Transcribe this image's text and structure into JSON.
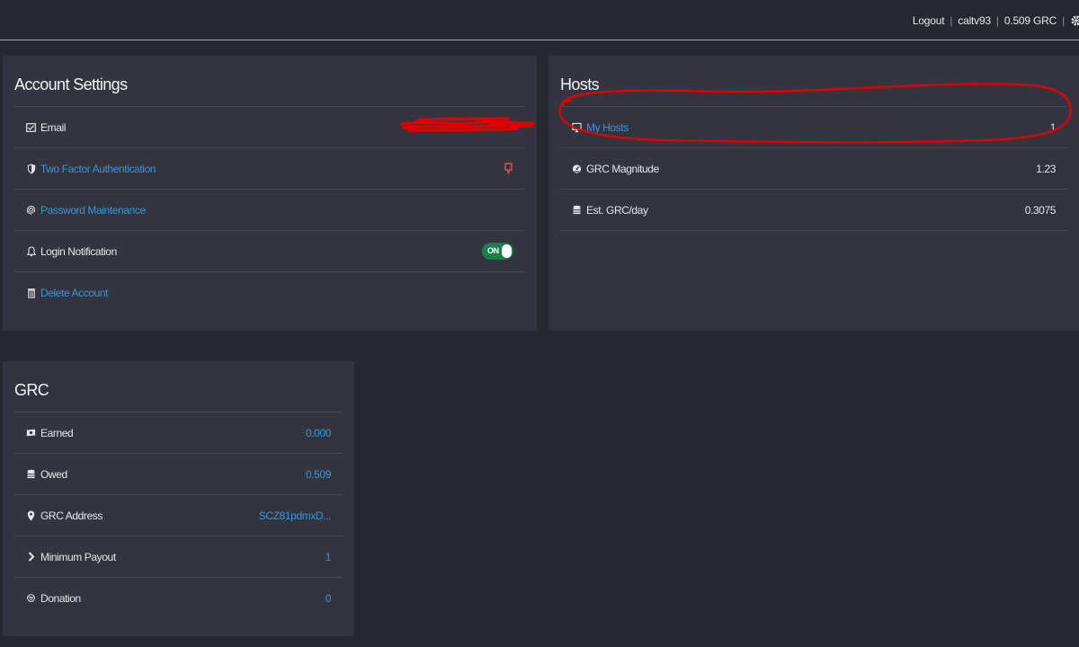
{
  "topnav": {
    "logout": "Logout",
    "username": "caltv93",
    "balance": "0.509 GRC"
  },
  "account": {
    "title": "Account Settings",
    "email_label": "Email",
    "twofa_label": "Two Factor Authentication",
    "password_label": "Password Maintenance",
    "login_notification_label": "Login Notification",
    "login_notification_state": "ON",
    "delete_label": "Delete Account"
  },
  "hosts": {
    "title": "Hosts",
    "my_hosts_label": "My Hosts",
    "my_hosts_value": "1",
    "magnitude_label": "GRC Magnitude",
    "magnitude_value": "1.23",
    "est_label": "Est. GRC/day",
    "est_value": "0.3075"
  },
  "grc": {
    "title": "GRC",
    "earned_label": "Earned",
    "earned_value": "0.000",
    "owed_label": "Owed",
    "owed_value": "0.509",
    "address_label": "GRC Address",
    "address_value": "SCZ81pdmxD...",
    "min_payout_label": "Minimum Payout",
    "min_payout_value": "1",
    "donation_label": "Donation",
    "donation_value": "0"
  },
  "colors": {
    "background": "#262830",
    "panel": "#32353f",
    "link": "#3d93d4",
    "toggle_on": "#1a7f4b",
    "annotation": "#e00000"
  }
}
